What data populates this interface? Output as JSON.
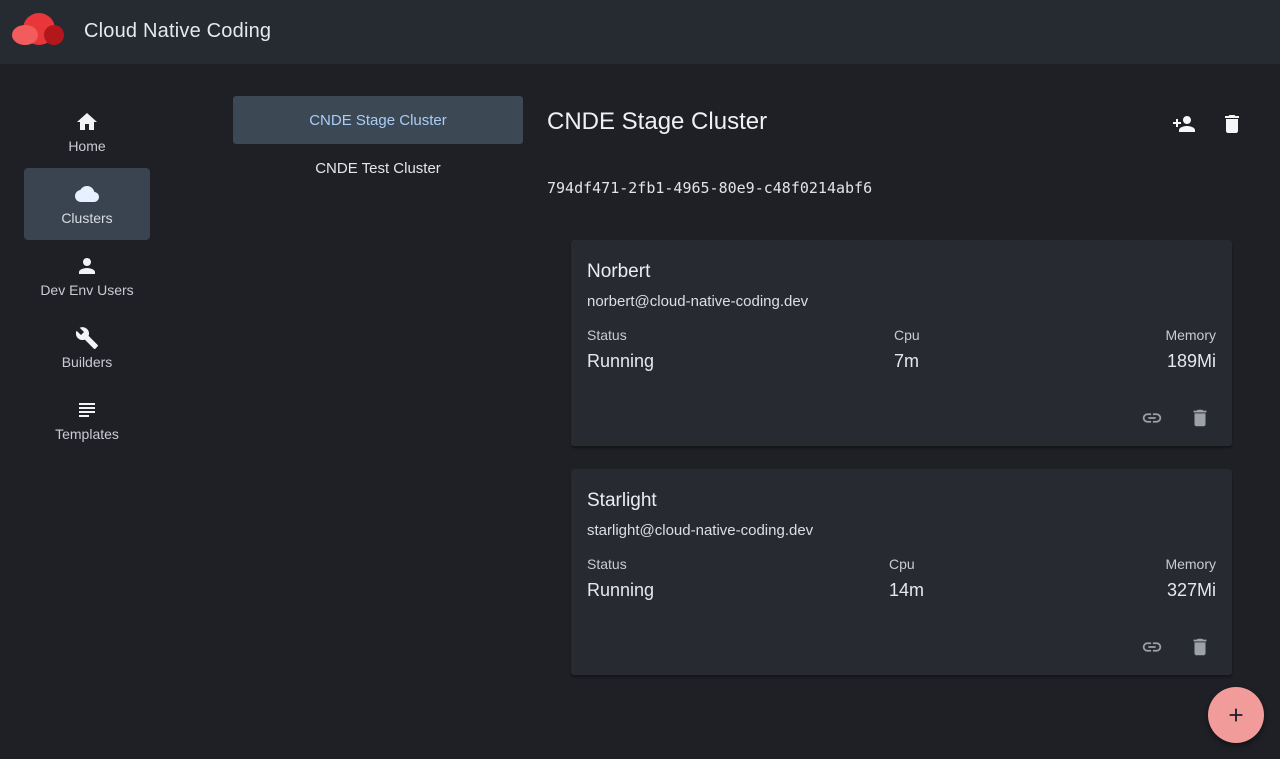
{
  "app": {
    "title": "Cloud Native Coding",
    "logo": "cloud-logo",
    "brand_colors": [
      "#e8363a",
      "#f25c5c",
      "#b3171b"
    ]
  },
  "nav": {
    "items": [
      {
        "label": "Home",
        "icon": "home-icon"
      },
      {
        "label": "Clusters",
        "icon": "cloud-icon",
        "active": true
      },
      {
        "label": "Dev Env Users",
        "icon": "person-icon"
      },
      {
        "label": "Builders",
        "icon": "wrench-icon"
      },
      {
        "label": "Templates",
        "icon": "list-icon"
      }
    ]
  },
  "clusters": {
    "items": [
      {
        "label": "CNDE Stage Cluster",
        "active": true
      },
      {
        "label": "CNDE Test Cluster"
      }
    ]
  },
  "detail": {
    "title": "CNDE Stage Cluster",
    "id": "794df471-2fb1-4965-80e9-c48f0214abf6",
    "actions": [
      "add-user-icon",
      "delete-icon"
    ]
  },
  "users": [
    {
      "name": "Norbert",
      "email": "norbert@cloud-native-coding.dev",
      "status_label": "Status",
      "status": "Running",
      "cpu_label": "Cpu",
      "cpu": "7m",
      "memory_label": "Memory",
      "memory": "189Mi"
    },
    {
      "name": "Starlight",
      "email": "starlight@cloud-native-coding.dev",
      "status_label": "Status",
      "status": "Running",
      "cpu_label": "Cpu",
      "cpu": "14m",
      "memory_label": "Memory",
      "memory": "327Mi"
    }
  ],
  "fab": {
    "icon": "plus-icon",
    "color": "#f29b9b"
  }
}
